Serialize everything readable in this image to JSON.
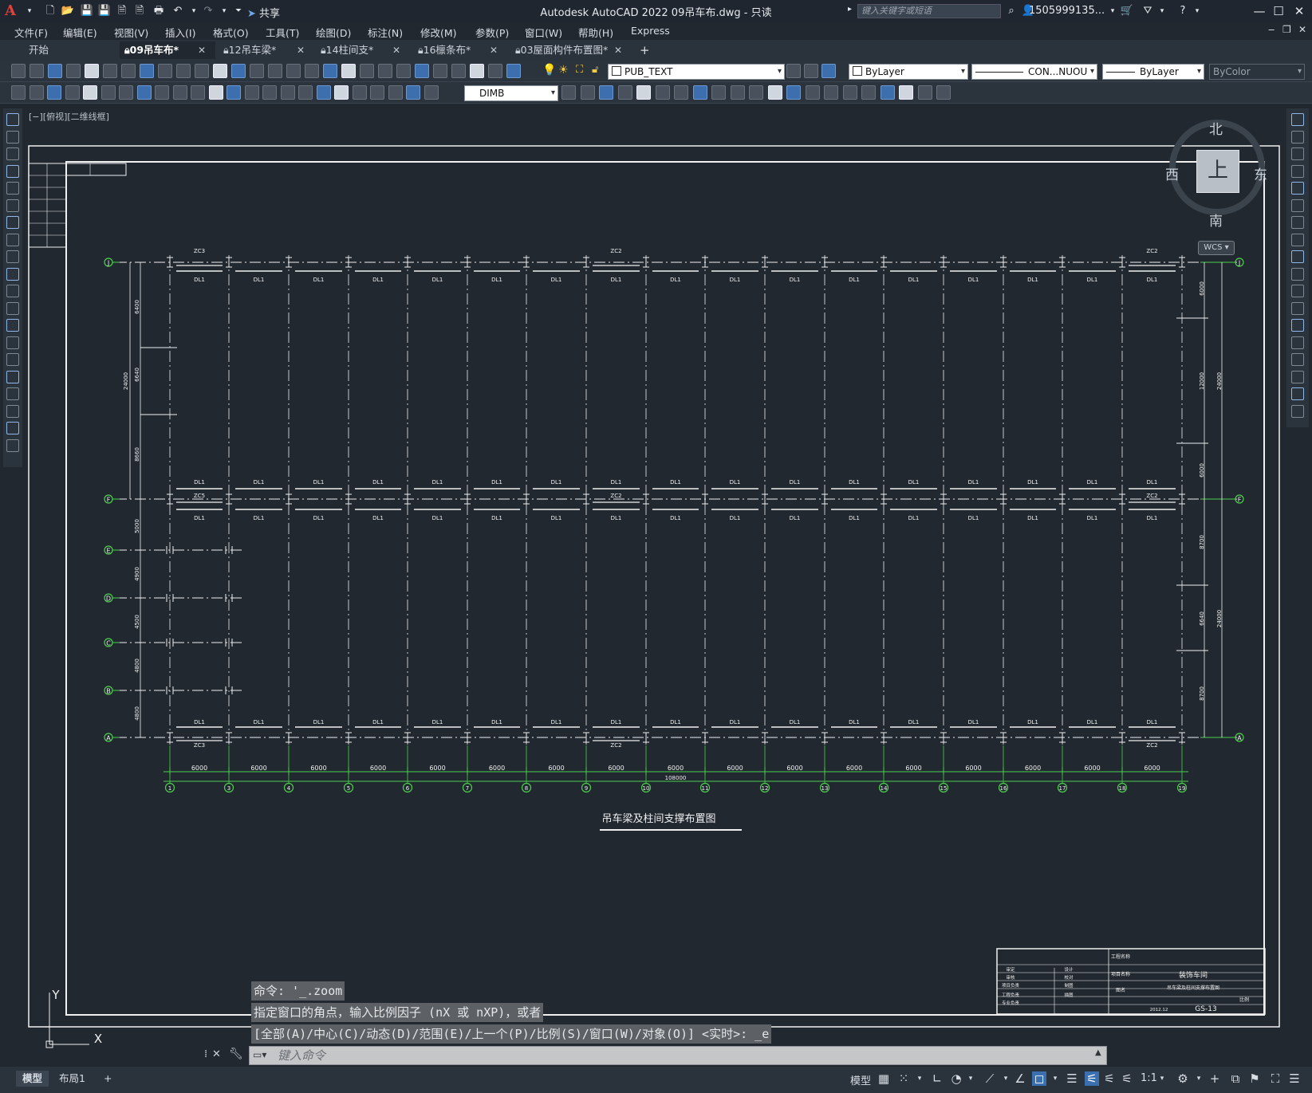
{
  "app": {
    "title": "Autodesk AutoCAD 2022    09吊车布.dwg - 只读",
    "logo": "A",
    "share_label": "共享",
    "search_placeholder": "键入关键字或短语",
    "user": "1505999135...",
    "window_controls": [
      "minimize-icon",
      "maximize-icon",
      "close-icon"
    ]
  },
  "menu": [
    "文件(F)",
    "编辑(E)",
    "视图(V)",
    "插入(I)",
    "格式(O)",
    "工具(T)",
    "绘图(D)",
    "标注(N)",
    "修改(M)",
    "参数(P)",
    "窗口(W)",
    "帮助(H)",
    "Express"
  ],
  "tabs": [
    {
      "label": "开始",
      "locked": false,
      "active": false
    },
    {
      "label": "09吊车布*",
      "locked": true,
      "active": true
    },
    {
      "label": "12吊车梁*",
      "locked": true,
      "active": false
    },
    {
      "label": "14柱间支*",
      "locked": true,
      "active": false
    },
    {
      "label": "16檩条布*",
      "locked": true,
      "active": false
    },
    {
      "label": "03屋面构件布置图*",
      "locked": true,
      "active": false
    }
  ],
  "toolbar": {
    "layer": "PUB_TEXT",
    "color": "ByLayer",
    "linetype": "CON...NUOU",
    "lineweight": "ByLayer",
    "plotstyle": "ByColor",
    "dimstyle": "DIMB"
  },
  "viewport": {
    "label": "[−][俯视][二维线框]"
  },
  "viewcube": {
    "north": "北",
    "south": "南",
    "east": "东",
    "west": "西",
    "top": "上",
    "wcs": "WCS"
  },
  "drawing": {
    "title": "吊车梁及柱间支撑布置图",
    "row_axes": [
      "J",
      "F",
      "E",
      "D",
      "C",
      "B",
      "A"
    ],
    "col_axes": [
      "1",
      "3",
      "4",
      "5",
      "6",
      "7",
      "8",
      "9",
      "10",
      "11",
      "12",
      "13",
      "14",
      "15",
      "16",
      "17",
      "18",
      "19"
    ],
    "bay_spacing": "6000",
    "total_length": "108000",
    "left_dims": [
      "6400",
      "6640",
      "8660",
      "5000",
      "4900",
      "4500",
      "4800",
      "4800"
    ],
    "right_dims": [
      "6000",
      "12000",
      "6000",
      "8700",
      "6640",
      "8700"
    ],
    "right_totals": [
      "24000",
      "24000"
    ],
    "title_block": {
      "project": "装饰车间",
      "drawing_name": "吊车梁及柱间支撑布置图",
      "drawing_no": "GS-13",
      "date": "2012.12",
      "scale_label": "比例",
      "fields": [
        "工程名称",
        "项目名称",
        "图名",
        "审定",
        "审核",
        "项目负责",
        "工程负责",
        "专业负责",
        "设计",
        "校对",
        "制图",
        "描图"
      ]
    }
  },
  "command": {
    "history": [
      "命令: '_.zoom",
      "指定窗口的角点，输入比例因子 (nX 或 nXP)，或者",
      "[全部(A)/中心(C)/动态(D)/范围(E)/上一个(P)/比例(S)/窗口(W)/对象(O)] <实时>: _e"
    ],
    "placeholder": "键入命令"
  },
  "layout_tabs": [
    "模型",
    "布局1"
  ],
  "status": {
    "model": "模型",
    "scale": "1:1"
  },
  "colors": {
    "background": "#212830",
    "axis_green": "#4bd14b",
    "lines": "#f0f0f0"
  }
}
